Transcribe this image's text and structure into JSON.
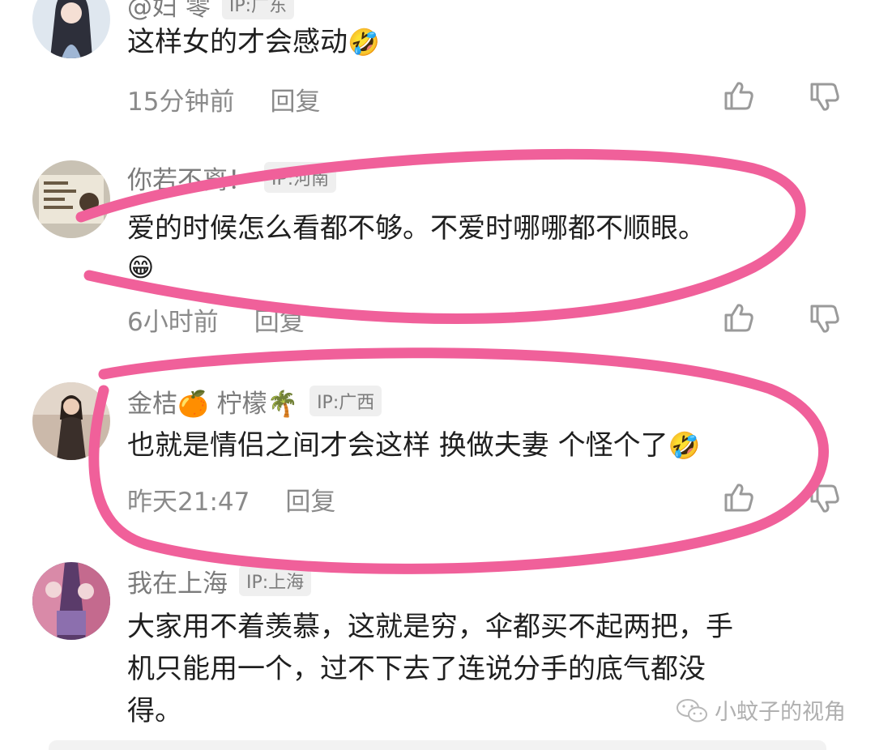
{
  "comments": [
    {
      "name": "@妇 零",
      "ip": "IP:广东",
      "text": "这样女的才会感动",
      "emoji": "🤣",
      "time": "15分钟前",
      "reply": "回复"
    },
    {
      "name": "你若不离！",
      "ip": "IP:河南",
      "text": "爱的时候怎么看都不够。不爱时哪哪都不顺眼。",
      "emoji": "😁",
      "time": "6小时前",
      "reply": "回复"
    },
    {
      "name": "金桔🍊 柠檬🌴",
      "ip": "IP:广西",
      "text": "也就是情侣之间才会这样 换做夫妻 个怪个了",
      "emoji": "🤣",
      "time": "昨天21:47",
      "reply": "回复"
    },
    {
      "name": "我在上海",
      "ip": "IP:上海",
      "text_lines": [
        "大家用不着羡慕，这就是穷，伞都买不起两把，手",
        "机只能用一个，过不下去了连说分手的底气都没",
        "得。"
      ]
    }
  ],
  "watermark": "小蚊子的视角",
  "icons": {
    "like": "thumbs-up-icon",
    "dislike": "thumbs-down-icon",
    "wechat": "wechat-icon"
  },
  "colors": {
    "highlight_stroke": "#f0609a",
    "muted_text": "#8a8a8a",
    "body_text": "#1f1f1f"
  }
}
